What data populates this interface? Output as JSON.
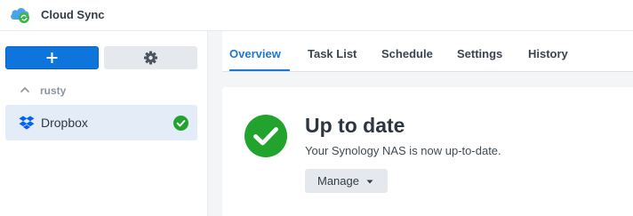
{
  "window": {
    "title": "Cloud Sync"
  },
  "sidebar": {
    "group": {
      "label": "rusty"
    },
    "items": [
      {
        "label": "Dropbox",
        "status": "ok"
      }
    ]
  },
  "tabs": [
    {
      "label": "Overview",
      "active": true
    },
    {
      "label": "Task List"
    },
    {
      "label": "Schedule"
    },
    {
      "label": "Settings"
    },
    {
      "label": "History"
    }
  ],
  "status": {
    "title": "Up to date",
    "description": "Your Synology NAS is now up-to-date.",
    "manage_label": "Manage"
  },
  "colors": {
    "accent": "#0e75dc",
    "success": "#21a32d",
    "selected_bg": "#e4ecf8"
  }
}
